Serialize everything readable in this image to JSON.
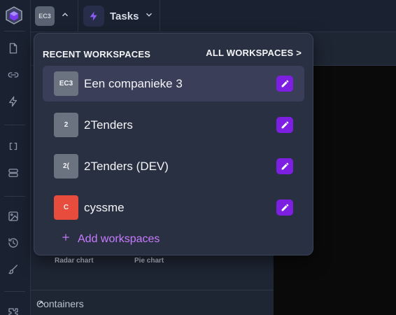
{
  "topbar": {
    "workspace_initials": "EC3",
    "app_name": "Tasks"
  },
  "rail": {
    "icons": [
      "file-icon",
      "link-icon",
      "bolt-icon",
      "brackets-icon",
      "database-icon",
      "image-icon",
      "history-icon",
      "brush-icon",
      "puzzle-icon"
    ]
  },
  "panel": {
    "tiles": [
      "Radar chart",
      "Pie chart"
    ],
    "section": "Containers"
  },
  "dropdown": {
    "recent_label": "RECENT WORKSPACES",
    "all_label": "ALL WORKSPACES >",
    "workspaces": [
      {
        "initials": "EC3",
        "name": "Een companieke 3",
        "color": "#6b7280",
        "active": true
      },
      {
        "initials": "2",
        "name": "2Tenders",
        "color": "#6b7280",
        "active": false
      },
      {
        "initials": "2(",
        "name": "2Tenders (DEV)",
        "color": "#6b7280",
        "active": false
      },
      {
        "initials": "C",
        "name": "cyssme",
        "color": "#e74c3c",
        "active": false
      }
    ],
    "add_label": "Add workspaces",
    "accent": "#7c1fe0",
    "link_color": "#c97bff"
  }
}
